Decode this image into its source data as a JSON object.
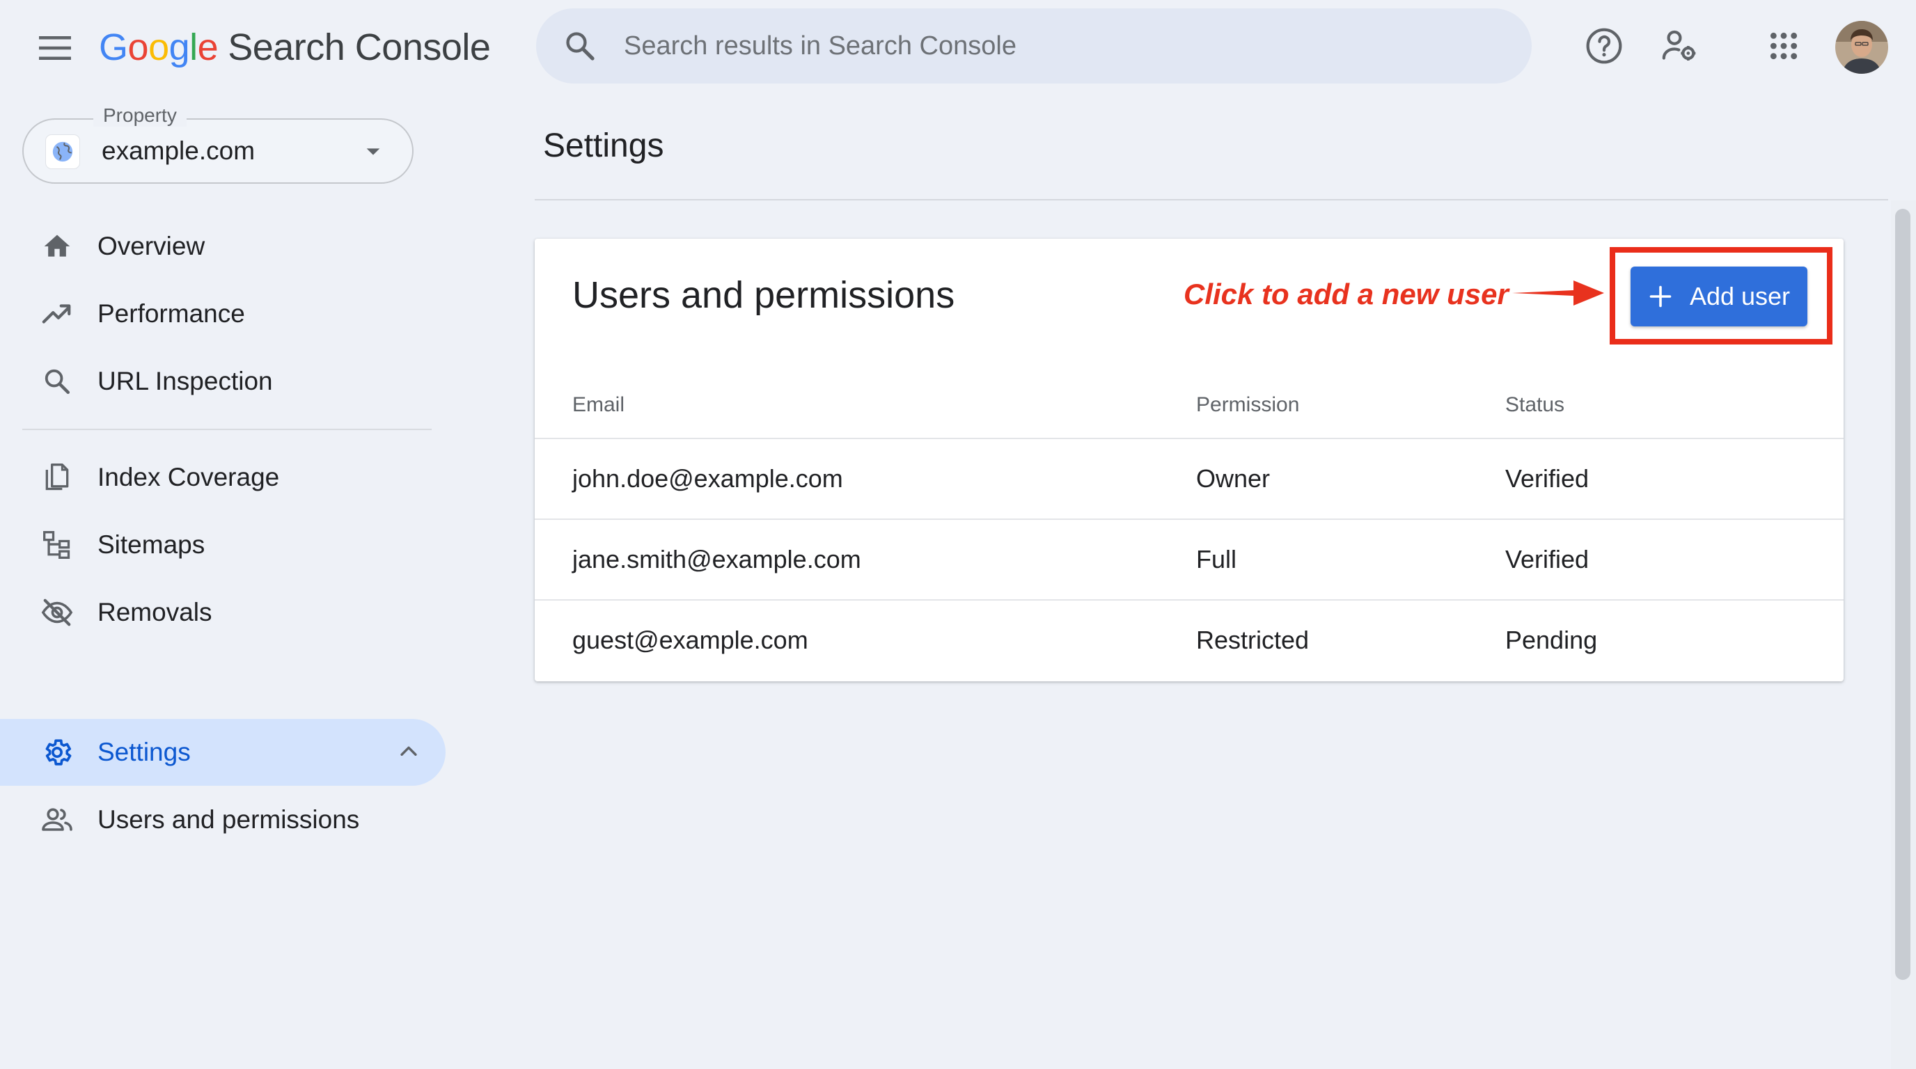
{
  "app": {
    "logo_letters": [
      "G",
      "o",
      "o",
      "g",
      "l",
      "e"
    ],
    "logo_colors": [
      "#4285f4",
      "#ea4335",
      "#fbbc05",
      "#4285f4",
      "#34a853",
      "#ea4335"
    ],
    "product_name": "Search Console"
  },
  "search": {
    "placeholder": "Search results in Search Console",
    "icon": "search-icon"
  },
  "header_icons": [
    "help-icon",
    "manage-account-icon",
    "apps-grid-icon",
    "avatar"
  ],
  "property": {
    "legend": "Property",
    "value": "example.com",
    "icon": "globe-icon"
  },
  "sidebar": {
    "items": [
      {
        "label": "Overview",
        "icon": "home-icon"
      },
      {
        "label": "Performance",
        "icon": "trending-up-icon"
      },
      {
        "label": "URL Inspection",
        "icon": "search-icon"
      },
      {
        "label": "Index Coverage",
        "icon": "file-copy-icon"
      },
      {
        "label": "Sitemaps",
        "icon": "sitemap-icon"
      },
      {
        "label": "Removals",
        "icon": "visibility-off-icon"
      },
      {
        "label": "Settings",
        "icon": "gear-icon",
        "active": true,
        "expanded": true
      },
      {
        "label": "Users and permissions",
        "icon": "people-icon"
      }
    ]
  },
  "main": {
    "page_title": "Settings",
    "card": {
      "title": "Users and permissions",
      "annotation": "Click to add a new user",
      "add_button_label": "Add user",
      "columns": [
        "Email",
        "Permission",
        "Status"
      ],
      "rows": [
        {
          "email": "john.doe@example.com",
          "permission": "Owner",
          "status": "Verified"
        },
        {
          "email": "jane.smith@example.com",
          "permission": "Full",
          "status": "Verified"
        },
        {
          "email": "guest@example.com",
          "permission": "Restricted",
          "status": "Pending"
        }
      ]
    }
  },
  "colors": {
    "accent": "#2f6fdb",
    "active_nav_bg": "#d3e3fd",
    "active_nav_text": "#0b57d0",
    "annotation_red": "#e8321e"
  }
}
